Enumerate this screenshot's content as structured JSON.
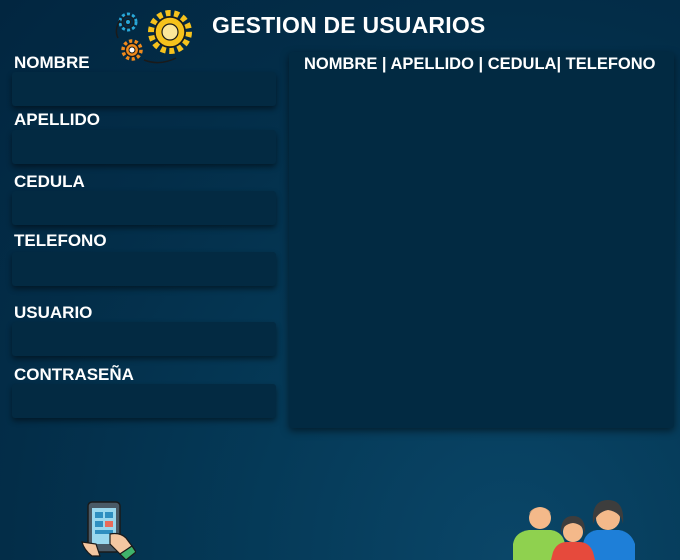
{
  "header": {
    "title": "GESTION DE USUARIOS",
    "icon": "gears-icon"
  },
  "form": {
    "fields": [
      {
        "label": "NOMBRE",
        "value": "",
        "placeholder": ""
      },
      {
        "label": "APELLIDO",
        "value": "",
        "placeholder": ""
      },
      {
        "label": "CEDULA",
        "value": "",
        "placeholder": ""
      },
      {
        "label": "TELEFONO",
        "value": "",
        "placeholder": ""
      },
      {
        "label": "USUARIO",
        "value": "",
        "placeholder": ""
      },
      {
        "label": "CONTRASEÑA",
        "value": "",
        "placeholder": ""
      }
    ]
  },
  "table": {
    "header": "NOMBRE | APELLIDO | CEDULA| TELEFONO",
    "rows": []
  },
  "decor": {
    "tablet_icon": "tablet-hand-icon",
    "people_icon": "users-group-icon"
  },
  "colors": {
    "background": "#043552",
    "panel": "#022a42",
    "text": "#ffffff",
    "gear_yellow": "#f6c21c",
    "gear_orange": "#f08a1c",
    "gear_blue": "#29a8d8"
  }
}
